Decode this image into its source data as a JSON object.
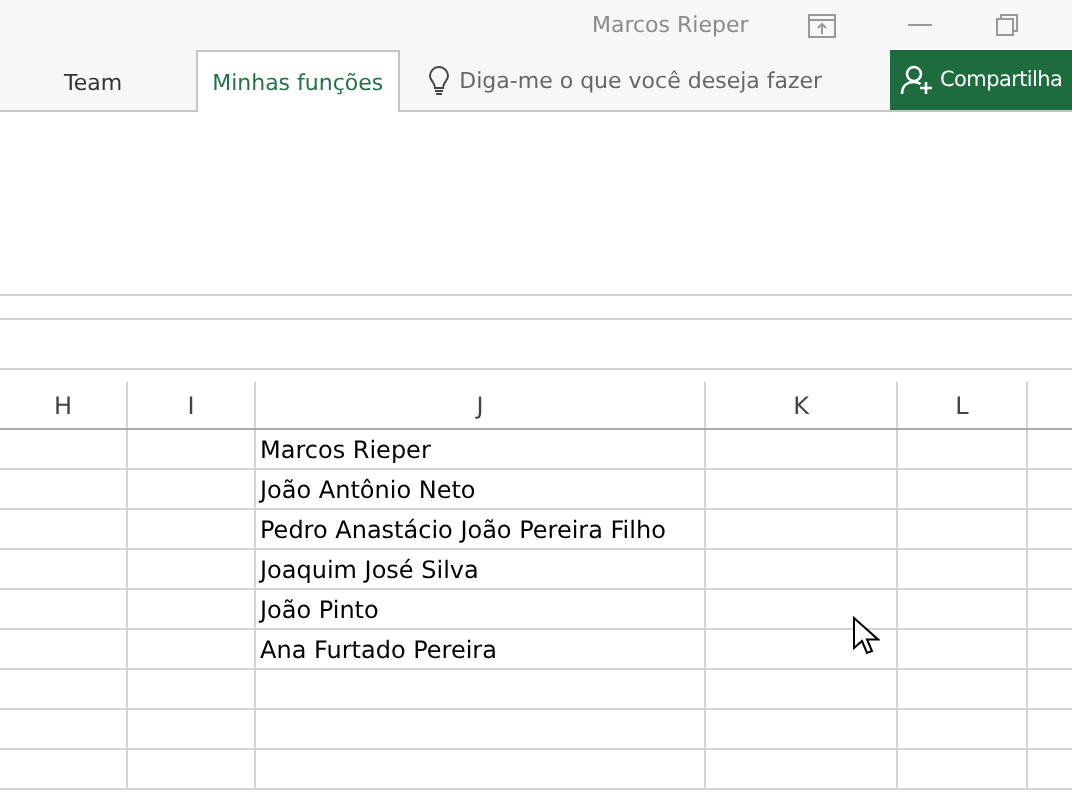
{
  "title_bar": {
    "user": "Marcos Rieper"
  },
  "ribbon_tabs": [
    {
      "label": "Team",
      "selected": false
    },
    {
      "label": "Minhas funções",
      "selected": true
    }
  ],
  "tell_me": {
    "placeholder": "Diga-me o que você deseja fazer"
  },
  "share_button": {
    "label": "Compartilha"
  },
  "sheet": {
    "columns": [
      "H",
      "I",
      "J",
      "K",
      "L"
    ],
    "rows": [
      {
        "J": "Marcos Rieper"
      },
      {
        "J": "João Antônio Neto"
      },
      {
        "J": "Pedro Anastácio João Pereira Filho"
      },
      {
        "J": "Joaquim José Silva"
      },
      {
        "J": "João Pinto"
      },
      {
        "J": "Ana Furtado Pereira"
      }
    ]
  }
}
